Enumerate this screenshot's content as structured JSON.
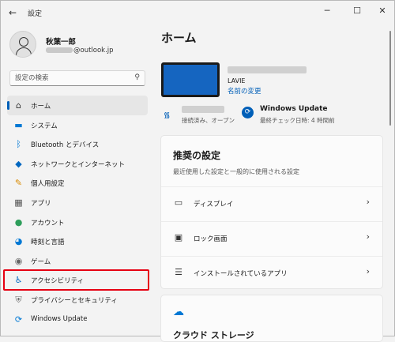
{
  "window": {
    "title": "設定",
    "back_label": "←",
    "minimize": "─",
    "maximize": "☐",
    "close": "✕"
  },
  "user": {
    "name": "秋葉一郎",
    "email_suffix": "@outlook.jp"
  },
  "search": {
    "placeholder": "設定の検索"
  },
  "sidebar": {
    "items": [
      {
        "label": "ホーム",
        "icon": "home-icon",
        "glyph": "⌂",
        "color": "#333333"
      },
      {
        "label": "システム",
        "icon": "system-icon",
        "glyph": "▬",
        "color": "#0078d4"
      },
      {
        "label": "Bluetooth とデバイス",
        "icon": "bluetooth-icon",
        "glyph": "ᛒ",
        "color": "#0078d4"
      },
      {
        "label": "ネットワークとインターネット",
        "icon": "network-icon",
        "glyph": "◆",
        "color": "#0067c0"
      },
      {
        "label": "個人用設定",
        "icon": "personalization-icon",
        "glyph": "✎",
        "color": "#d98a00"
      },
      {
        "label": "アプリ",
        "icon": "apps-icon",
        "glyph": "▦",
        "color": "#555555"
      },
      {
        "label": "アカウント",
        "icon": "accounts-icon",
        "glyph": "●",
        "color": "#2e9e5b"
      },
      {
        "label": "時刻と言語",
        "icon": "time-language-icon",
        "glyph": "◕",
        "color": "#0078d4"
      },
      {
        "label": "ゲーム",
        "icon": "gaming-icon",
        "glyph": "◉",
        "color": "#666666"
      },
      {
        "label": "アクセシビリティ",
        "icon": "accessibility-icon",
        "glyph": "♿",
        "color": "#0067c0"
      },
      {
        "label": "プライバシーとセキュリティ",
        "icon": "privacy-shield-icon",
        "glyph": "⛨",
        "color": "#6b6b6b"
      },
      {
        "label": "Windows Update",
        "icon": "windows-update-icon",
        "glyph": "⟳",
        "color": "#0078d4"
      }
    ]
  },
  "main": {
    "title": "ホーム",
    "device": {
      "model": "LAVIE",
      "rename": "名前の変更"
    },
    "wifi": {
      "status": "接続済み、オープン"
    },
    "windows_update": {
      "title": "Windows Update",
      "status": "最終チェック日時: 4 時間前"
    },
    "recommended": {
      "title": "推奨の設定",
      "subtitle": "最近使用した設定と一般的に使用される設定",
      "rows": [
        {
          "label": "ディスプレイ",
          "icon": "display-icon",
          "glyph": "▭"
        },
        {
          "label": "ロック画面",
          "icon": "lock-screen-icon",
          "glyph": "▣"
        },
        {
          "label": "インストールされているアプリ",
          "icon": "installed-apps-icon",
          "glyph": "☰"
        }
      ],
      "chevron": "›"
    },
    "cloud": {
      "title": "クラウド ストレージ"
    }
  },
  "colors": {
    "accent": "#005fb8",
    "highlight_border": "#e60012"
  }
}
